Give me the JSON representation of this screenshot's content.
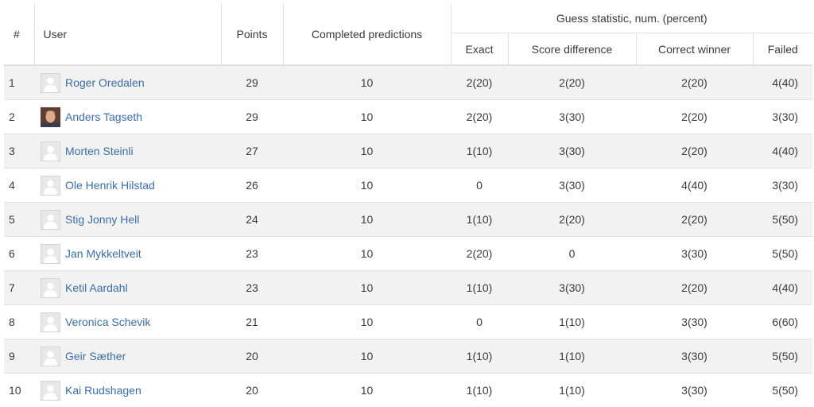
{
  "headers": {
    "rank": "#",
    "user": "User",
    "points": "Points",
    "completed": "Completed predictions",
    "guess_group": "Guess statistic, num. (percent)",
    "exact": "Exact",
    "score_diff": "Score difference",
    "correct_winner": "Correct winner",
    "failed": "Failed"
  },
  "rows": [
    {
      "rank": "1",
      "name": "Roger Oredalen",
      "avatar": "default-avatar-icon",
      "points": "29",
      "completed": "10",
      "exact": "2(20)",
      "score_diff": "2(20)",
      "correct_winner": "2(20)",
      "failed": "4(40)"
    },
    {
      "rank": "2",
      "name": "Anders Tagseth",
      "avatar": "user-photo",
      "points": "29",
      "completed": "10",
      "exact": "2(20)",
      "score_diff": "3(30)",
      "correct_winner": "2(20)",
      "failed": "3(30)"
    },
    {
      "rank": "3",
      "name": "Morten Steinli",
      "avatar": "default-avatar-icon",
      "points": "27",
      "completed": "10",
      "exact": "1(10)",
      "score_diff": "3(30)",
      "correct_winner": "2(20)",
      "failed": "4(40)"
    },
    {
      "rank": "4",
      "name": "Ole Henrik Hilstad",
      "avatar": "default-avatar-icon",
      "points": "26",
      "completed": "10",
      "exact": "0",
      "score_diff": "3(30)",
      "correct_winner": "4(40)",
      "failed": "3(30)"
    },
    {
      "rank": "5",
      "name": "Stig Jonny Hell",
      "avatar": "default-avatar-icon",
      "points": "24",
      "completed": "10",
      "exact": "1(10)",
      "score_diff": "2(20)",
      "correct_winner": "2(20)",
      "failed": "5(50)"
    },
    {
      "rank": "6",
      "name": "Jan Mykkeltveit",
      "avatar": "default-avatar-icon",
      "points": "23",
      "completed": "10",
      "exact": "2(20)",
      "score_diff": "0",
      "correct_winner": "3(30)",
      "failed": "5(50)"
    },
    {
      "rank": "7",
      "name": "Ketil Aardahl",
      "avatar": "default-avatar-icon",
      "points": "23",
      "completed": "10",
      "exact": "1(10)",
      "score_diff": "3(30)",
      "correct_winner": "2(20)",
      "failed": "4(40)"
    },
    {
      "rank": "8",
      "name": "Veronica Schevik",
      "avatar": "default-avatar-icon",
      "points": "21",
      "completed": "10",
      "exact": "0",
      "score_diff": "1(10)",
      "correct_winner": "3(30)",
      "failed": "6(60)"
    },
    {
      "rank": "9",
      "name": "Geir Sæther",
      "avatar": "default-avatar-icon",
      "points": "20",
      "completed": "10",
      "exact": "1(10)",
      "score_diff": "1(10)",
      "correct_winner": "3(30)",
      "failed": "5(50)"
    },
    {
      "rank": "10",
      "name": "Kai Rudshagen",
      "avatar": "default-avatar-icon",
      "points": "20",
      "completed": "10",
      "exact": "1(10)",
      "score_diff": "1(10)",
      "correct_winner": "3(30)",
      "failed": "5(50)"
    }
  ],
  "colors": {
    "link": "#3b6ea5",
    "stripe": "#f2f2f2",
    "border": "#dee2e6"
  }
}
